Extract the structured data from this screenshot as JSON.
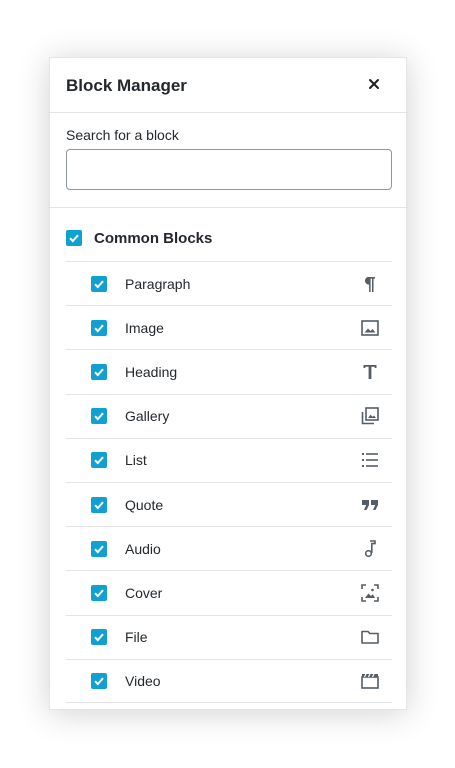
{
  "modal": {
    "title": "Block Manager",
    "close_icon": "close-icon"
  },
  "search": {
    "label": "Search for a block",
    "value": "",
    "placeholder": ""
  },
  "category": {
    "label": "Common Blocks",
    "checked": true
  },
  "blocks": [
    {
      "label": "Paragraph",
      "icon": "paragraph-icon",
      "checked": true
    },
    {
      "label": "Image",
      "icon": "image-icon",
      "checked": true
    },
    {
      "label": "Heading",
      "icon": "heading-icon",
      "checked": true
    },
    {
      "label": "Gallery",
      "icon": "gallery-icon",
      "checked": true
    },
    {
      "label": "List",
      "icon": "list-icon",
      "checked": true
    },
    {
      "label": "Quote",
      "icon": "quote-icon",
      "checked": true
    },
    {
      "label": "Audio",
      "icon": "audio-icon",
      "checked": true
    },
    {
      "label": "Cover",
      "icon": "cover-icon",
      "checked": true
    },
    {
      "label": "File",
      "icon": "file-icon",
      "checked": true
    },
    {
      "label": "Video",
      "icon": "video-icon",
      "checked": true
    }
  ],
  "colors": {
    "checkbox": "#11a0d2",
    "divider": "#e2e4e7",
    "icon": "#555d66"
  }
}
